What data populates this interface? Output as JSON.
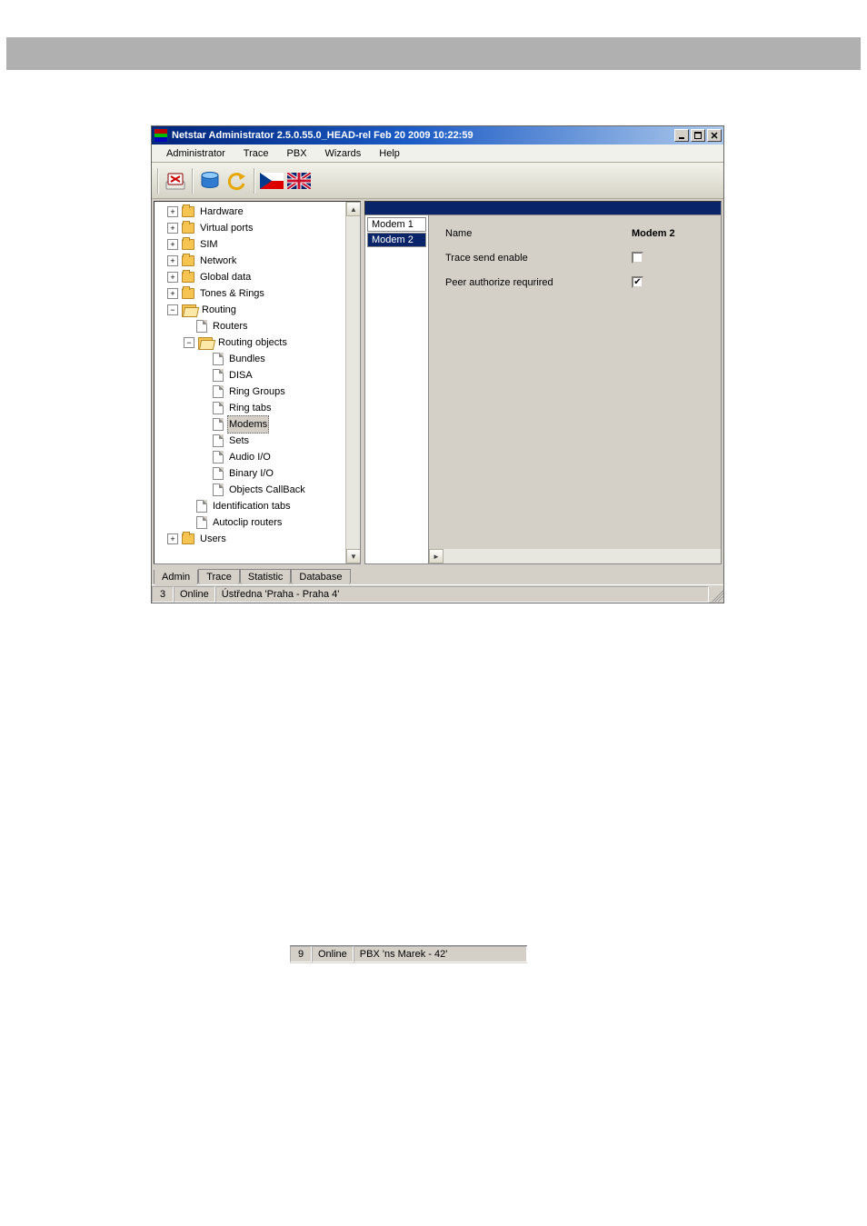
{
  "window": {
    "title": "Netstar Administrator 2.5.0.55.0_HEAD-rel Feb 20 2009 10:22:59"
  },
  "menu": {
    "items": [
      "Administrator",
      "Trace",
      "PBX",
      "Wizards",
      "Help"
    ]
  },
  "toolbar": {
    "icons": [
      "exit-icon",
      "database-icon",
      "undo-icon",
      "flag-cz-icon",
      "flag-uk-icon"
    ]
  },
  "tree": {
    "nodes": [
      {
        "label": "Hardware",
        "depth": 0,
        "expander": "plus",
        "icon": "folder"
      },
      {
        "label": "Virtual ports",
        "depth": 0,
        "expander": "plus",
        "icon": "folder"
      },
      {
        "label": "SIM",
        "depth": 0,
        "expander": "plus",
        "icon": "folder"
      },
      {
        "label": "Network",
        "depth": 0,
        "expander": "plus",
        "icon": "folder"
      },
      {
        "label": "Global data",
        "depth": 0,
        "expander": "plus",
        "icon": "folder"
      },
      {
        "label": "Tones & Rings",
        "depth": 0,
        "expander": "plus",
        "icon": "folder"
      },
      {
        "label": "Routing",
        "depth": 0,
        "expander": "minus",
        "icon": "folder-open"
      },
      {
        "label": "Routers",
        "depth": 1,
        "expander": "",
        "icon": "page"
      },
      {
        "label": "Routing objects",
        "depth": 1,
        "expander": "minus",
        "icon": "folder-open"
      },
      {
        "label": "Bundles",
        "depth": 2,
        "expander": "",
        "icon": "page"
      },
      {
        "label": "DISA",
        "depth": 2,
        "expander": "",
        "icon": "page"
      },
      {
        "label": "Ring Groups",
        "depth": 2,
        "expander": "",
        "icon": "page"
      },
      {
        "label": "Ring tabs",
        "depth": 2,
        "expander": "",
        "icon": "page"
      },
      {
        "label": "Modems",
        "depth": 2,
        "expander": "",
        "icon": "page",
        "selected": true
      },
      {
        "label": "Sets",
        "depth": 2,
        "expander": "",
        "icon": "page"
      },
      {
        "label": "Audio I/O",
        "depth": 2,
        "expander": "",
        "icon": "page"
      },
      {
        "label": "Binary I/O",
        "depth": 2,
        "expander": "",
        "icon": "page"
      },
      {
        "label": "Objects CallBack",
        "depth": 2,
        "expander": "",
        "icon": "page"
      },
      {
        "label": "Identification tabs",
        "depth": 1,
        "expander": "",
        "icon": "page"
      },
      {
        "label": "Autoclip routers",
        "depth": 1,
        "expander": "",
        "icon": "page"
      },
      {
        "label": "Users",
        "depth": 0,
        "expander": "plus",
        "icon": "folder"
      }
    ]
  },
  "modem_list": {
    "items": [
      "Modem 1",
      "Modem 2"
    ],
    "selected_index": 1
  },
  "detail": {
    "rows": [
      {
        "label": "Name",
        "value": "Modem 2",
        "type": "text"
      },
      {
        "label": "Trace send enable",
        "type": "checkbox",
        "checked": false
      },
      {
        "label": "Peer authorize requrired",
        "type": "checkbox",
        "checked": true
      }
    ]
  },
  "tabs": {
    "items": [
      "Admin",
      "Trace",
      "Statistic",
      "Database"
    ],
    "active_index": 0
  },
  "statusbar": {
    "count": "3",
    "status": "Online",
    "text": "Ústředna 'Praha - Praha 4'"
  },
  "mini_statusbar": {
    "count": "9",
    "status": "Online",
    "text": "PBX 'ns Marek - 42'"
  }
}
